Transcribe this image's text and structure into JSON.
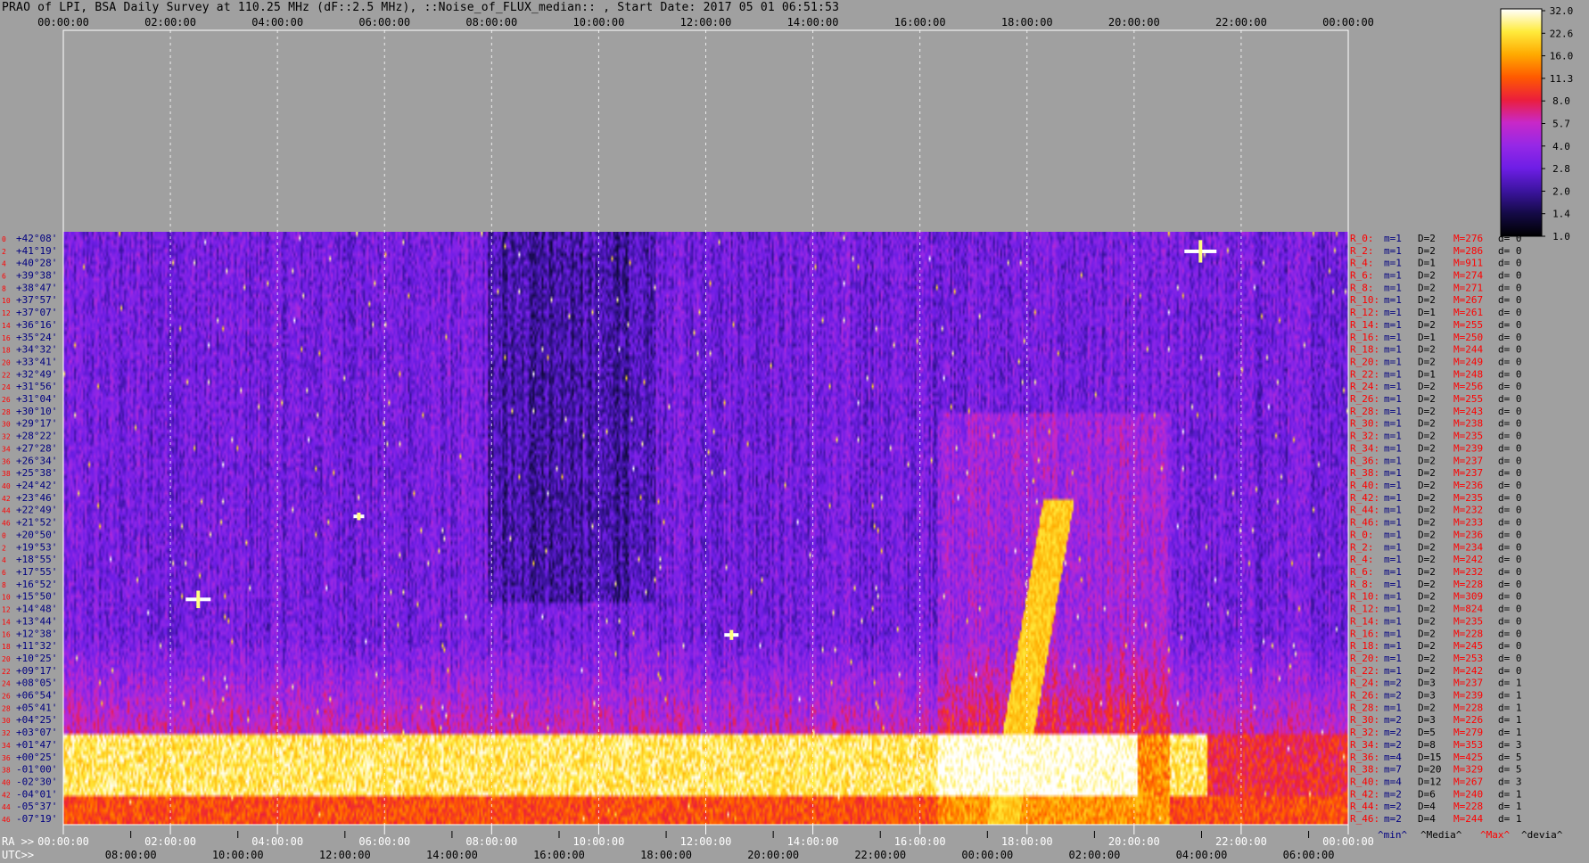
{
  "title": "PRAO of LPI, BSA Daily Survey at 110.25 MHz (dF::2.5 MHz), ::Noise_of_FLUX_median:: , Start Date: 2017 05 01 06:51:53",
  "colors": {
    "background": "#a0a0a0",
    "utc_labels": "#000000",
    "ra_labels": "#ffffff",
    "dec_labels": "#000080",
    "beam_index": "#ff0000",
    "stat_m": "#000080",
    "stat_M": "#ff0000"
  },
  "chart_data": {
    "type": "heatmap",
    "title": "PRAO of LPI, BSA Daily Survey at 110.25 MHz (dF::2.5 MHz), ::Noise_of_FLUX_median:: , Start Date: 2017 05 01 06:51:53",
    "top_time_ticks": [
      "00:00:00",
      "02:00:00",
      "04:00:00",
      "06:00:00",
      "08:00:00",
      "10:00:00",
      "12:00:00",
      "14:00:00",
      "16:00:00",
      "18:00:00",
      "20:00:00",
      "22:00:00",
      "00:00:00"
    ],
    "ra_axis": {
      "prefix": "RA >>",
      "ticks": [
        "00:00:00",
        "02:00:00",
        "04:00:00",
        "06:00:00",
        "08:00:00",
        "10:00:00",
        "12:00:00",
        "14:00:00",
        "16:00:00",
        "18:00:00",
        "20:00:00",
        "22:00:00",
        "00:00:00"
      ]
    },
    "utc_axis": {
      "prefix": "UTC>>",
      "ticks": [
        "08:00:00",
        "10:00:00",
        "12:00:00",
        "14:00:00",
        "16:00:00",
        "18:00:00",
        "20:00:00",
        "22:00:00",
        "00:00:00",
        "02:00:00",
        "04:00:00",
        "06:00:00"
      ]
    },
    "colorbar": {
      "ticks": [
        "32.0",
        "22.6",
        "16.0",
        "11.3",
        "8.0",
        "5.7",
        "4.0",
        "2.8",
        "2.0",
        "1.4",
        "1.0"
      ],
      "range": [
        1.0,
        32.0
      ],
      "scale": "log"
    },
    "rows": [
      {
        "i": "0",
        "dec": "+42°08'",
        "beam": "R_0:",
        "m": "m=1",
        "D": "D=2",
        "M": "M=276",
        "d": "d= 0"
      },
      {
        "i": "2",
        "dec": "+41°19'",
        "beam": "R_2:",
        "m": "m=1",
        "D": "D=2",
        "M": "M=286",
        "d": "d= 0"
      },
      {
        "i": "4",
        "dec": "+40°28'",
        "beam": "R_4:",
        "m": "m=1",
        "D": "D=1",
        "M": "M=911",
        "d": "d= 0"
      },
      {
        "i": "6",
        "dec": "+39°38'",
        "beam": "R_6:",
        "m": "m=1",
        "D": "D=2",
        "M": "M=274",
        "d": "d= 0"
      },
      {
        "i": "8",
        "dec": "+38°47'",
        "beam": "R_8:",
        "m": "m=1",
        "D": "D=2",
        "M": "M=271",
        "d": "d= 0"
      },
      {
        "i": "10",
        "dec": "+37°57'",
        "beam": "R_10:",
        "m": "m=1",
        "D": "D=2",
        "M": "M=267",
        "d": "d= 0"
      },
      {
        "i": "12",
        "dec": "+37°07'",
        "beam": "R_12:",
        "m": "m=1",
        "D": "D=1",
        "M": "M=261",
        "d": "d= 0"
      },
      {
        "i": "14",
        "dec": "+36°16'",
        "beam": "R_14:",
        "m": "m=1",
        "D": "D=2",
        "M": "M=255",
        "d": "d= 0"
      },
      {
        "i": "16",
        "dec": "+35°24'",
        "beam": "R_16:",
        "m": "m=1",
        "D": "D=1",
        "M": "M=250",
        "d": "d= 0"
      },
      {
        "i": "18",
        "dec": "+34°32'",
        "beam": "R_18:",
        "m": "m=1",
        "D": "D=2",
        "M": "M=244",
        "d": "d= 0"
      },
      {
        "i": "20",
        "dec": "+33°41'",
        "beam": "R_20:",
        "m": "m=1",
        "D": "D=2",
        "M": "M=249",
        "d": "d= 0"
      },
      {
        "i": "22",
        "dec": "+32°49'",
        "beam": "R_22:",
        "m": "m=1",
        "D": "D=1",
        "M": "M=248",
        "d": "d= 0"
      },
      {
        "i": "24",
        "dec": "+31°56'",
        "beam": "R_24:",
        "m": "m=1",
        "D": "D=2",
        "M": "M=256",
        "d": "d= 0"
      },
      {
        "i": "26",
        "dec": "+31°04'",
        "beam": "R_26:",
        "m": "m=1",
        "D": "D=2",
        "M": "M=255",
        "d": "d= 0"
      },
      {
        "i": "28",
        "dec": "+30°10'",
        "beam": "R_28:",
        "m": "m=1",
        "D": "D=2",
        "M": "M=243",
        "d": "d= 0"
      },
      {
        "i": "30",
        "dec": "+29°17'",
        "beam": "R_30:",
        "m": "m=1",
        "D": "D=2",
        "M": "M=238",
        "d": "d= 0"
      },
      {
        "i": "32",
        "dec": "+28°22'",
        "beam": "R_32:",
        "m": "m=1",
        "D": "D=2",
        "M": "M=235",
        "d": "d= 0"
      },
      {
        "i": "34",
        "dec": "+27°28'",
        "beam": "R_34:",
        "m": "m=1",
        "D": "D=2",
        "M": "M=239",
        "d": "d= 0"
      },
      {
        "i": "36",
        "dec": "+26°34'",
        "beam": "R_36:",
        "m": "m=1",
        "D": "D=2",
        "M": "M=237",
        "d": "d= 0"
      },
      {
        "i": "38",
        "dec": "+25°38'",
        "beam": "R_38:",
        "m": "m=1",
        "D": "D=2",
        "M": "M=237",
        "d": "d= 0"
      },
      {
        "i": "40",
        "dec": "+24°42'",
        "beam": "R_40:",
        "m": "m=1",
        "D": "D=2",
        "M": "M=236",
        "d": "d= 0"
      },
      {
        "i": "42",
        "dec": "+23°46'",
        "beam": "R_42:",
        "m": "m=1",
        "D": "D=2",
        "M": "M=235",
        "d": "d= 0"
      },
      {
        "i": "44",
        "dec": "+22°49'",
        "beam": "R_44:",
        "m": "m=1",
        "D": "D=2",
        "M": "M=232",
        "d": "d= 0"
      },
      {
        "i": "46",
        "dec": "+21°52'",
        "beam": "R_46:",
        "m": "m=1",
        "D": "D=2",
        "M": "M=233",
        "d": "d= 0"
      },
      {
        "i": "0",
        "dec": "+20°50'",
        "beam": "R_0:",
        "m": "m=1",
        "D": "D=2",
        "M": "M=236",
        "d": "d= 0"
      },
      {
        "i": "2",
        "dec": "+19°53'",
        "beam": "R_2:",
        "m": "m=1",
        "D": "D=2",
        "M": "M=234",
        "d": "d= 0"
      },
      {
        "i": "4",
        "dec": "+18°55'",
        "beam": "R_4:",
        "m": "m=1",
        "D": "D=2",
        "M": "M=242",
        "d": "d= 0"
      },
      {
        "i": "6",
        "dec": "+17°55'",
        "beam": "R_6:",
        "m": "m=1",
        "D": "D=2",
        "M": "M=232",
        "d": "d= 0"
      },
      {
        "i": "8",
        "dec": "+16°52'",
        "beam": "R_8:",
        "m": "m=1",
        "D": "D=2",
        "M": "M=228",
        "d": "d= 0"
      },
      {
        "i": "10",
        "dec": "+15°50'",
        "beam": "R_10:",
        "m": "m=1",
        "D": "D=2",
        "M": "M=309",
        "d": "d= 0"
      },
      {
        "i": "12",
        "dec": "+14°48'",
        "beam": "R_12:",
        "m": "m=1",
        "D": "D=2",
        "M": "M=824",
        "d": "d= 0"
      },
      {
        "i": "14",
        "dec": "+13°44'",
        "beam": "R_14:",
        "m": "m=1",
        "D": "D=2",
        "M": "M=235",
        "d": "d= 0"
      },
      {
        "i": "16",
        "dec": "+12°38'",
        "beam": "R_16:",
        "m": "m=1",
        "D": "D=2",
        "M": "M=228",
        "d": "d= 0"
      },
      {
        "i": "18",
        "dec": "+11°32'",
        "beam": "R_18:",
        "m": "m=1",
        "D": "D=2",
        "M": "M=245",
        "d": "d= 0"
      },
      {
        "i": "20",
        "dec": "+10°25'",
        "beam": "R_20:",
        "m": "m=1",
        "D": "D=2",
        "M": "M=253",
        "d": "d= 0"
      },
      {
        "i": "22",
        "dec": "+09°17'",
        "beam": "R_22:",
        "m": "m=1",
        "D": "D=2",
        "M": "M=242",
        "d": "d= 0"
      },
      {
        "i": "24",
        "dec": "+08°05'",
        "beam": "R_24:",
        "m": "m=2",
        "D": "D=3",
        "M": "M=237",
        "d": "d= 1"
      },
      {
        "i": "26",
        "dec": "+06°54'",
        "beam": "R_26:",
        "m": "m=2",
        "D": "D=3",
        "M": "M=239",
        "d": "d= 1"
      },
      {
        "i": "28",
        "dec": "+05°41'",
        "beam": "R_28:",
        "m": "m=1",
        "D": "D=2",
        "M": "M=228",
        "d": "d= 1"
      },
      {
        "i": "30",
        "dec": "+04°25'",
        "beam": "R_30:",
        "m": "m=2",
        "D": "D=3",
        "M": "M=226",
        "d": "d= 1"
      },
      {
        "i": "32",
        "dec": "+03°07'",
        "beam": "R_32:",
        "m": "m=2",
        "D": "D=5",
        "M": "M=279",
        "d": "d= 1"
      },
      {
        "i": "34",
        "dec": "+01°47'",
        "beam": "R_34:",
        "m": "m=2",
        "D": "D=8",
        "M": "M=353",
        "d": "d= 3"
      },
      {
        "i": "36",
        "dec": "+00°25'",
        "beam": "R_36:",
        "m": "m=4",
        "D": "D=15",
        "M": "M=425",
        "d": "d= 5"
      },
      {
        "i": "38",
        "dec": "-01°00'",
        "beam": "R_38:",
        "m": "m=7",
        "D": "D=20",
        "M": "M=329",
        "d": "d= 5"
      },
      {
        "i": "40",
        "dec": "-02°30'",
        "beam": "R_40:",
        "m": "m=4",
        "D": "D=12",
        "M": "M=267",
        "d": "d= 3"
      },
      {
        "i": "42",
        "dec": "-04°01'",
        "beam": "R_42:",
        "m": "m=2",
        "D": "D=6",
        "M": "M=240",
        "d": "d= 1"
      },
      {
        "i": "44",
        "dec": "-05°37'",
        "beam": "R_44:",
        "m": "m=2",
        "D": "D=4",
        "M": "M=228",
        "d": "d= 1"
      },
      {
        "i": "46",
        "dec": "-07°19'",
        "beam": "R_46:",
        "m": "m=2",
        "D": "D=4",
        "M": "M=244",
        "d": "d= 1"
      }
    ],
    "legend_bottom": [
      "^min^",
      "^Media^",
      "^Max^",
      "^devia^"
    ],
    "legend_colors": [
      "#000080",
      "#000000",
      "#ff0000",
      "#000000"
    ]
  }
}
